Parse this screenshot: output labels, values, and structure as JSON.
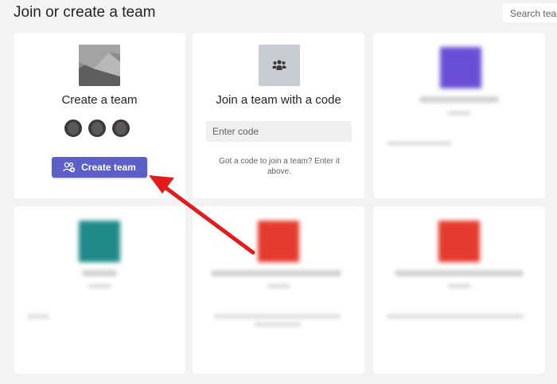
{
  "page": {
    "title": "Join or create a team"
  },
  "search": {
    "placeholder": "Search teams"
  },
  "create_card": {
    "title": "Create a team",
    "button_label": "Create team",
    "button_color": "#5b5fc7"
  },
  "join_card": {
    "title": "Join a team with a code",
    "input_placeholder": "Enter code",
    "hint": "Got a code to join a team? Enter it above."
  },
  "blurred_teams": [
    {
      "color": "#6a4fd6"
    },
    {
      "color": "#1f8a89"
    },
    {
      "color": "#e53b2f"
    },
    {
      "color": "#e53b2f"
    }
  ],
  "annotation": {
    "arrow_color": "#e31b1b"
  }
}
